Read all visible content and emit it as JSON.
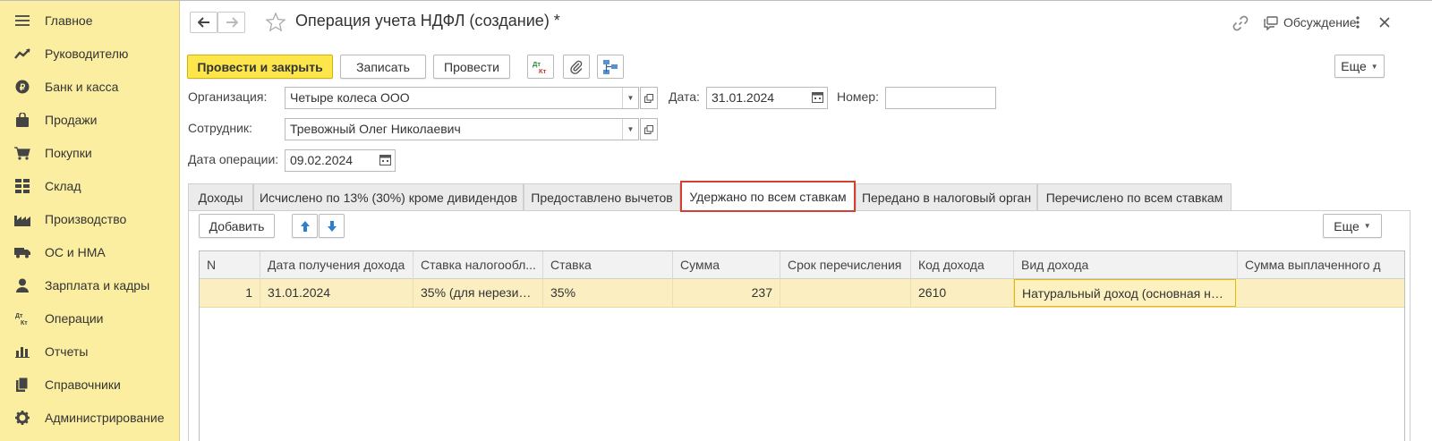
{
  "sidebar": {
    "items": [
      {
        "label": "Главное",
        "icon": "menu-icon"
      },
      {
        "label": "Руководителю",
        "icon": "trend-icon"
      },
      {
        "label": "Банк и касса",
        "icon": "ruble-coin-icon"
      },
      {
        "label": "Продажи",
        "icon": "shopping-bag-icon"
      },
      {
        "label": "Покупки",
        "icon": "cart-icon"
      },
      {
        "label": "Склад",
        "icon": "warehouse-icon"
      },
      {
        "label": "Производство",
        "icon": "factory-icon"
      },
      {
        "label": "ОС и НМА",
        "icon": "truck-icon"
      },
      {
        "label": "Зарплата и кадры",
        "icon": "person-icon"
      },
      {
        "label": "Операции",
        "icon": "dt-kt-icon"
      },
      {
        "label": "Отчеты",
        "icon": "bar-chart-icon"
      },
      {
        "label": "Справочники",
        "icon": "books-icon"
      },
      {
        "label": "Администрирование",
        "icon": "gear-icon"
      }
    ]
  },
  "header": {
    "title": "Операция учета НДФЛ (создание) *",
    "discussion_label": "Обсуждение"
  },
  "toolbar": {
    "post_close_label": "Провести и закрыть",
    "save_label": "Записать",
    "post_label": "Провести",
    "dtkt_icon_text_top": "Дт",
    "dtkt_icon_text_bottom": "Кт",
    "more_label": "Еще"
  },
  "form": {
    "org_label": "Организация:",
    "org_value": "Четыре колеса ООО",
    "date_label": "Дата:",
    "date_value": "31.01.2024",
    "number_label": "Номер:",
    "number_value": "",
    "employee_label": "Сотрудник:",
    "employee_value": "Тревожный Олег Николаевич",
    "op_date_label": "Дата операции:",
    "op_date_value": "09.02.2024"
  },
  "tabs": [
    {
      "label": "Доходы"
    },
    {
      "label": "Исчислено по 13% (30%) кроме дивидендов"
    },
    {
      "label": "Предоставлено вычетов"
    },
    {
      "label": "Удержано по всем ставкам"
    },
    {
      "label": "Передано в налоговый орган"
    },
    {
      "label": "Перечислено по всем ставкам"
    }
  ],
  "panel": {
    "add_label": "Добавить",
    "more_label": "Еще"
  },
  "table": {
    "columns": [
      "N",
      "Дата получения дохода",
      "Ставка налогообл...",
      "Ставка",
      "Сумма",
      "Срок перечисления",
      "Код дохода",
      "Вид дохода",
      "Сумма выплаченного д"
    ],
    "rows": [
      [
        "1",
        "31.01.2024",
        "35% (для нерезид...",
        "35%",
        "237",
        "",
        "2610",
        "Натуральный доход (основная на...",
        ""
      ]
    ]
  },
  "colors": {
    "sidebar_bg": "#fbeea0",
    "primary_button": "#fde64b",
    "active_tab_border": "#d33f33",
    "selected_row": "#fbefc2",
    "arrow_blue": "#2f7fd0"
  }
}
